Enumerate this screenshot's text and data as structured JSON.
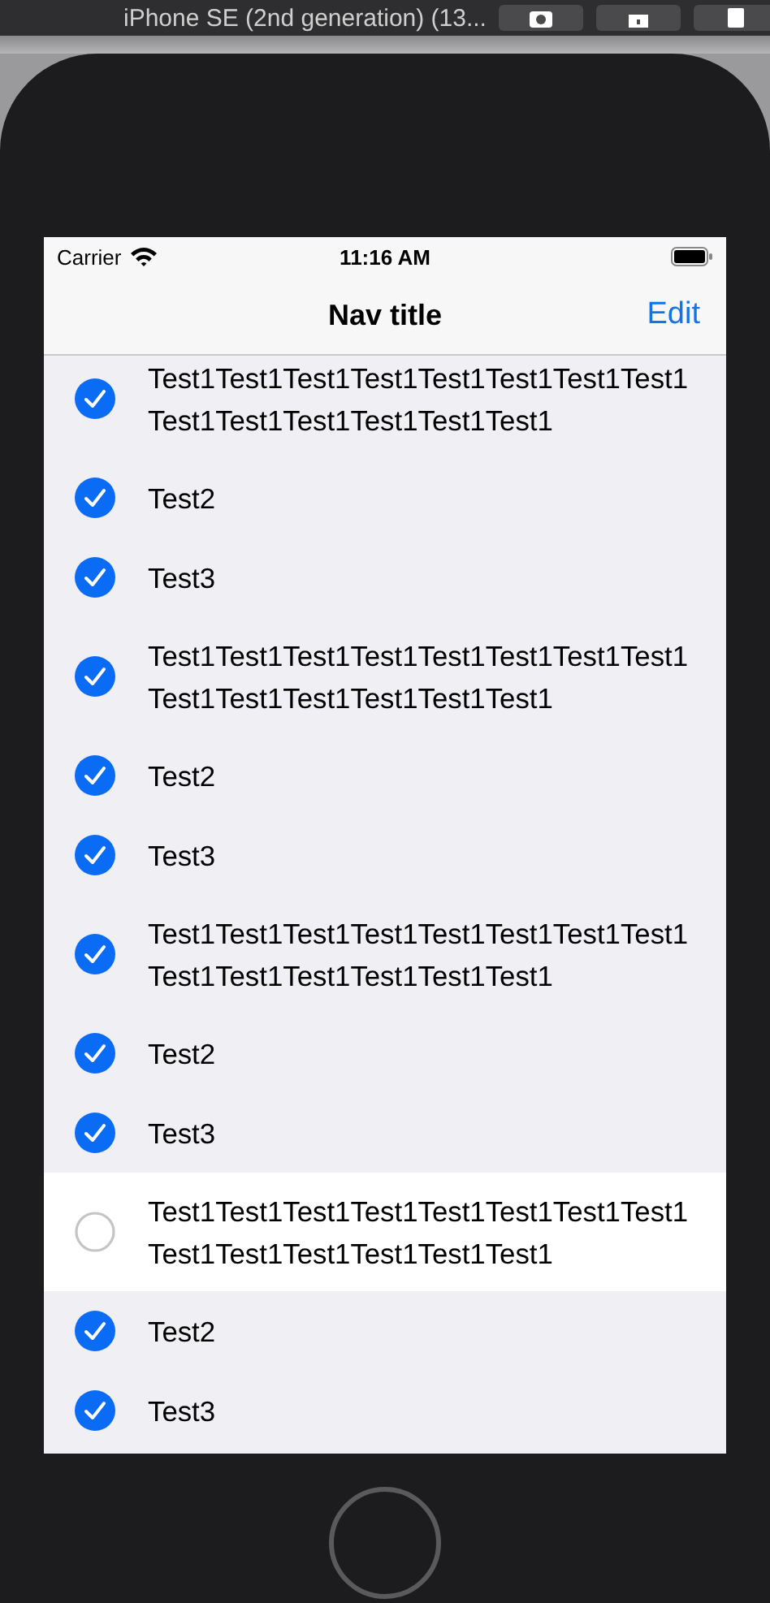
{
  "window": {
    "title": "iPhone SE (2nd generation) (13..."
  },
  "status_bar": {
    "carrier": "Carrier",
    "time": "11:16 AM"
  },
  "nav": {
    "title": "Nav title",
    "action": "Edit"
  },
  "rows": [
    {
      "text": "Test1Test1Test1Test1Test1Test1Test1Test1Test1Test1Test1Test1Test1Test1",
      "checked": true,
      "selected": true
    },
    {
      "text": "Test2",
      "checked": true,
      "selected": true
    },
    {
      "text": "Test3",
      "checked": true,
      "selected": true
    },
    {
      "text": "Test1Test1Test1Test1Test1Test1Test1Test1Test1Test1Test1Test1Test1Test1",
      "checked": true,
      "selected": true
    },
    {
      "text": "Test2",
      "checked": true,
      "selected": true
    },
    {
      "text": "Test3",
      "checked": true,
      "selected": true
    },
    {
      "text": "Test1Test1Test1Test1Test1Test1Test1Test1Test1Test1Test1Test1Test1Test1",
      "checked": true,
      "selected": true
    },
    {
      "text": "Test2",
      "checked": true,
      "selected": true
    },
    {
      "text": "Test3",
      "checked": true,
      "selected": true
    },
    {
      "text": "Test1Test1Test1Test1Test1Test1Test1Test1Test1Test1Test1Test1Test1Test1",
      "checked": false,
      "selected": false
    },
    {
      "text": "Test2",
      "checked": true,
      "selected": true
    },
    {
      "text": "Test3",
      "checked": true,
      "selected": true
    }
  ]
}
